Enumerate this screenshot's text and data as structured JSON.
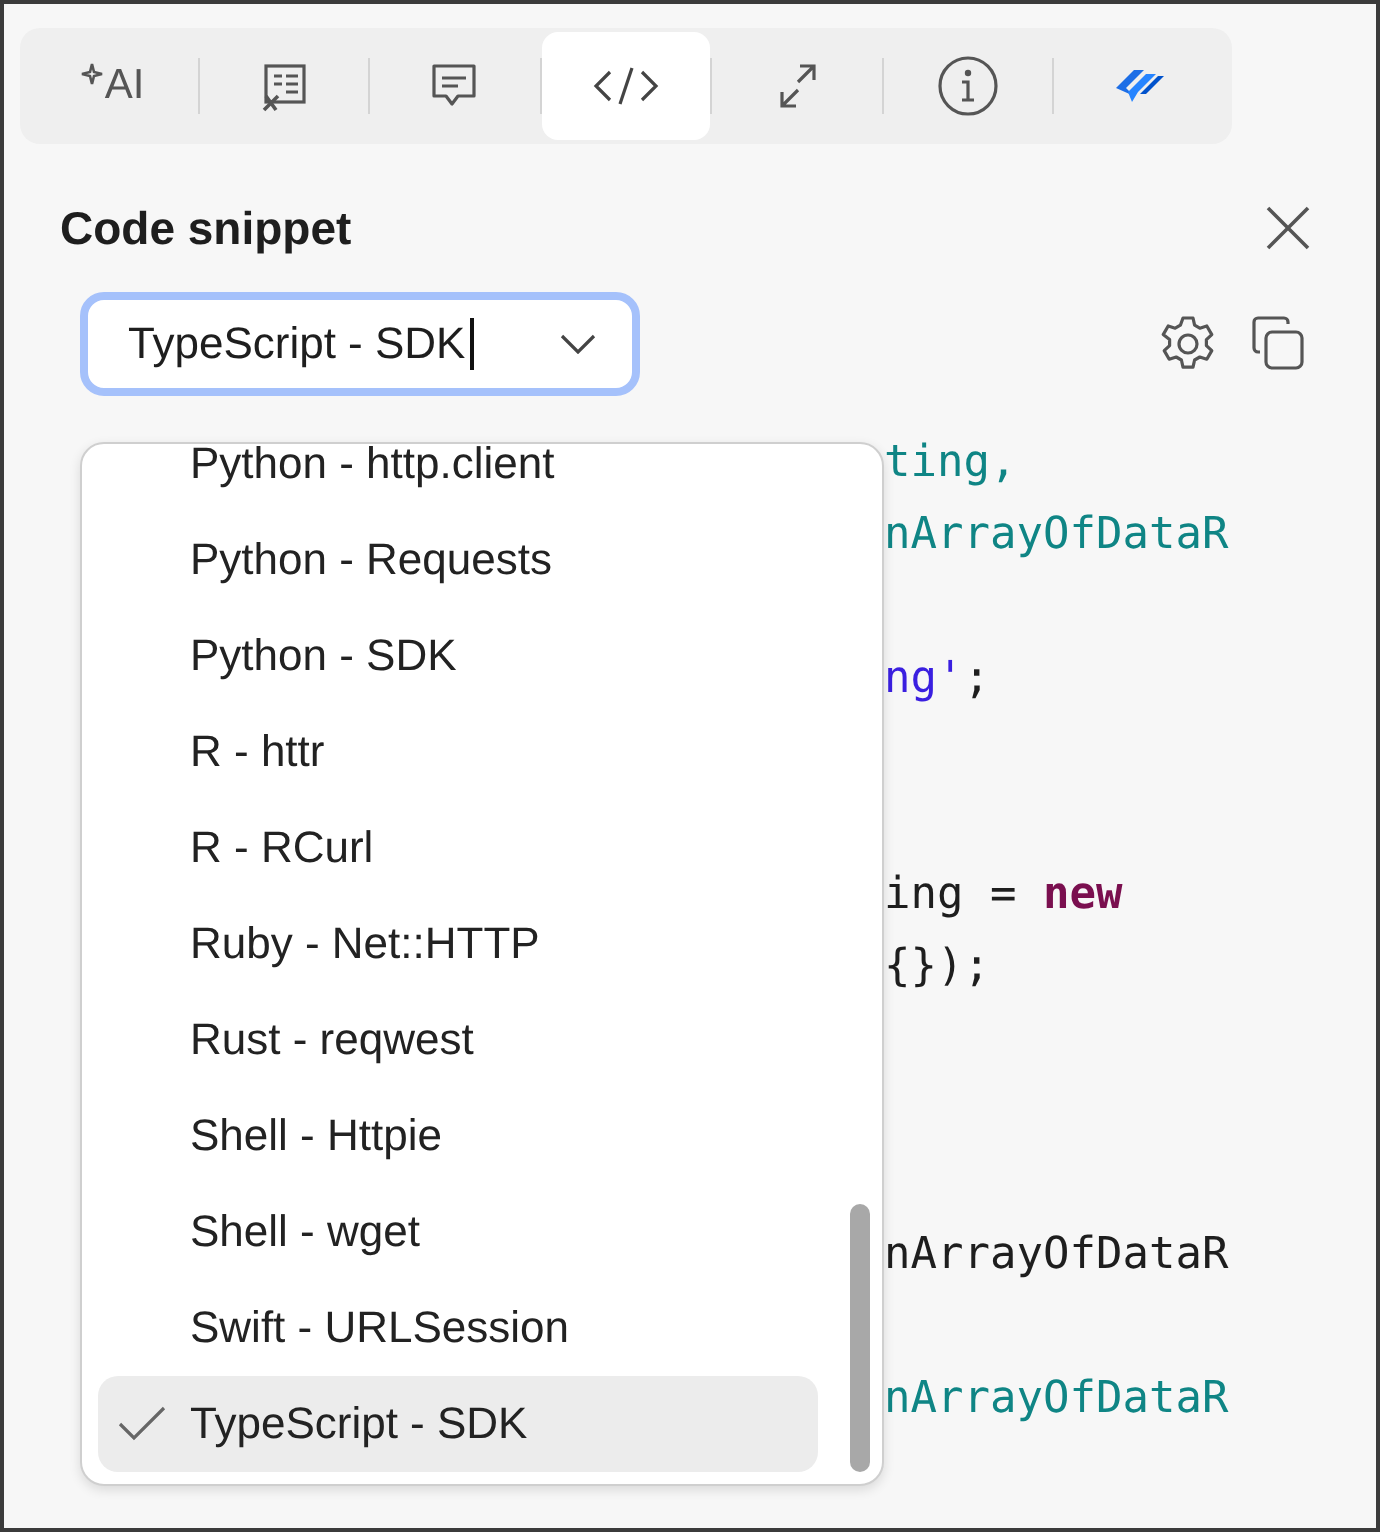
{
  "toolbar": {
    "tabs": [
      {
        "kind": "ai",
        "label": "AI",
        "selected": false
      },
      {
        "kind": "formula",
        "selected": false
      },
      {
        "kind": "comment",
        "selected": false
      },
      {
        "kind": "code",
        "selected": true
      },
      {
        "kind": "arrows",
        "selected": false
      },
      {
        "kind": "info",
        "selected": false
      },
      {
        "kind": "jira",
        "selected": false
      }
    ]
  },
  "panel": {
    "title": "Code snippet"
  },
  "language_select": {
    "value": "TypeScript - SDK"
  },
  "code_blocks": [
    [
      [
        {
          "kind": "type",
          "text": "ting,"
        }
      ],
      [
        {
          "kind": "type",
          "text": "nArrayOfDataR"
        }
      ]
    ],
    [
      [
        {
          "kind": "string",
          "text": "ng'"
        },
        {
          "kind": "plain",
          "text": ";"
        }
      ]
    ],
    [
      [
        {
          "kind": "plain",
          "text": "ing = "
        },
        {
          "kind": "keyword",
          "text": "new"
        }
      ],
      [
        {
          "kind": "plain",
          "text": "{});"
        }
      ]
    ],
    [
      [
        {
          "kind": "plain",
          "text": "nArrayOfDataR"
        }
      ]
    ],
    [
      [
        {
          "kind": "type",
          "text": "nArrayOfDataR"
        }
      ]
    ]
  ],
  "dropdown": {
    "options": [
      {
        "label": "Python - http.client",
        "selected": false
      },
      {
        "label": "Python - Requests",
        "selected": false
      },
      {
        "label": "Python - SDK",
        "selected": false
      },
      {
        "label": "R - httr",
        "selected": false
      },
      {
        "label": "R - RCurl",
        "selected": false
      },
      {
        "label": "Ruby - Net::HTTP",
        "selected": false
      },
      {
        "label": "Rust - reqwest",
        "selected": false
      },
      {
        "label": "Shell - Httpie",
        "selected": false
      },
      {
        "label": "Shell - wget",
        "selected": false
      },
      {
        "label": "Swift - URLSession",
        "selected": false
      },
      {
        "label": "TypeScript - SDK",
        "selected": true
      }
    ]
  }
}
